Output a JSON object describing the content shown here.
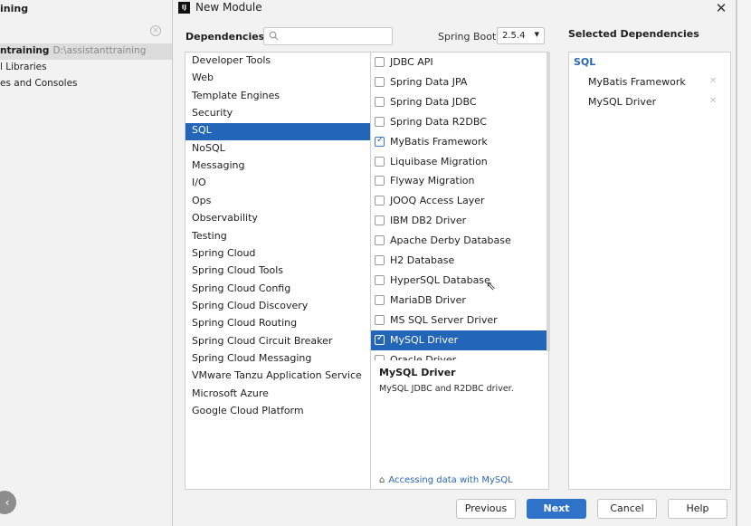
{
  "background_ide": {
    "title_fragment": "ining",
    "project_name": "ntraining",
    "project_path": "D:\\assistanttraining",
    "row_libraries": "l Libraries",
    "row_scratches": "es and Consoles"
  },
  "dialog": {
    "title": "New Module",
    "dependencies_label": "Dependencies",
    "search_placeholder": "",
    "spring_boot_label": "Spring Boot",
    "spring_boot_version": "2.5.4",
    "selected_dependencies_label": "Selected Dependencies"
  },
  "categories": [
    {
      "label": "Developer Tools"
    },
    {
      "label": "Web"
    },
    {
      "label": "Template Engines"
    },
    {
      "label": "Security"
    },
    {
      "label": "SQL"
    },
    {
      "label": "NoSQL"
    },
    {
      "label": "Messaging"
    },
    {
      "label": "I/O"
    },
    {
      "label": "Ops"
    },
    {
      "label": "Observability"
    },
    {
      "label": "Testing"
    },
    {
      "label": "Spring Cloud"
    },
    {
      "label": "Spring Cloud Tools"
    },
    {
      "label": "Spring Cloud Config"
    },
    {
      "label": "Spring Cloud Discovery"
    },
    {
      "label": "Spring Cloud Routing"
    },
    {
      "label": "Spring Cloud Circuit Breaker"
    },
    {
      "label": "Spring Cloud Messaging"
    },
    {
      "label": "VMware Tanzu Application Service"
    },
    {
      "label": "Microsoft Azure"
    },
    {
      "label": "Google Cloud Platform"
    }
  ],
  "selected_category": "SQL",
  "dependencies": [
    {
      "label": "JDBC API",
      "checked": false
    },
    {
      "label": "Spring Data JPA",
      "checked": false
    },
    {
      "label": "Spring Data JDBC",
      "checked": false
    },
    {
      "label": "Spring Data R2DBC",
      "checked": false
    },
    {
      "label": "MyBatis Framework",
      "checked": true
    },
    {
      "label": "Liquibase Migration",
      "checked": false
    },
    {
      "label": "Flyway Migration",
      "checked": false
    },
    {
      "label": "JOOQ Access Layer",
      "checked": false
    },
    {
      "label": "IBM DB2 Driver",
      "checked": false
    },
    {
      "label": "Apache Derby Database",
      "checked": false
    },
    {
      "label": "H2 Database",
      "checked": false
    },
    {
      "label": "HyperSQL Database",
      "checked": false
    },
    {
      "label": "MariaDB Driver",
      "checked": false
    },
    {
      "label": "MS SQL Server Driver",
      "checked": false
    },
    {
      "label": "MySQL Driver",
      "checked": true
    },
    {
      "label": "Oracle Driver",
      "checked": false
    }
  ],
  "selected_dependency": "MySQL Driver",
  "details": {
    "title": "MySQL Driver",
    "description": "MySQL JDBC and R2DBC driver.",
    "link": "Accessing data with MySQL"
  },
  "selected_panel": {
    "group": "SQL",
    "items": [
      "MyBatis Framework",
      "MySQL Driver"
    ]
  },
  "buttons": {
    "previous": "Previous",
    "next": "Next",
    "cancel": "Cancel",
    "help": "Help"
  }
}
